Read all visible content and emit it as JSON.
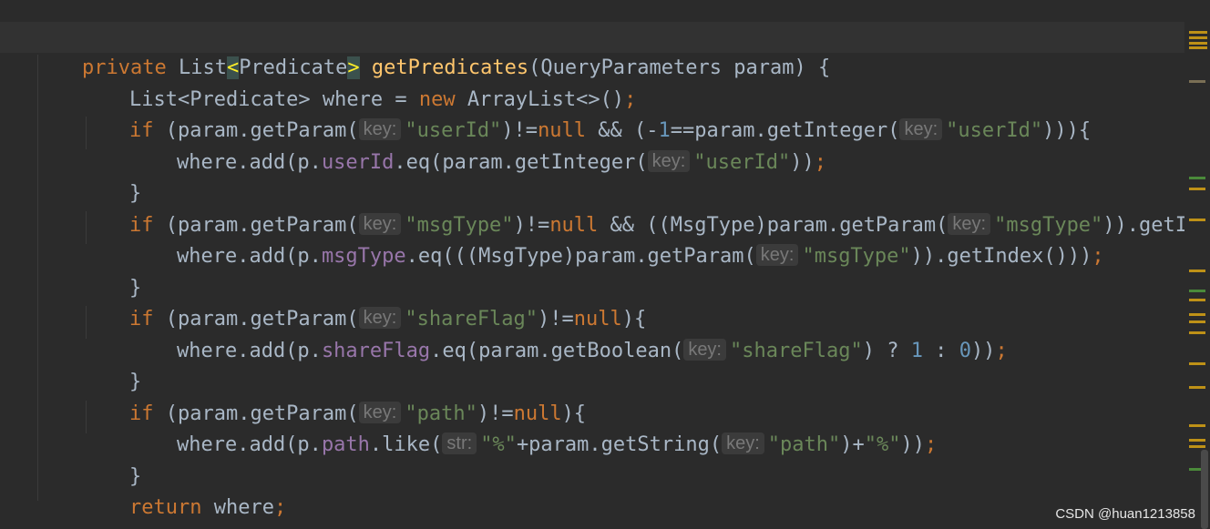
{
  "editor": {
    "lines": {
      "l1": {
        "kw_private": "private",
        "type_list": "List",
        "lt": "<",
        "generic": "Predicate",
        "gt": ">",
        "method": "getPredicates",
        "params": "(QueryParameters param) {"
      },
      "l2": {
        "a": "List<Predicate> where = ",
        "kw_new": "new",
        "b": " ArrayList<>()",
        "semi": ";"
      },
      "l3": {
        "kw_if": "if",
        "a": " (param.getParam(",
        "hint": "key:",
        "s1": "\"userId\"",
        "b": ")!=",
        "kw_null": "null",
        "c": " && (-",
        "n1": "1",
        "d": "==param.getInteger(",
        "hint2": "key:",
        "s2": "\"userId\"",
        "e": "))){"
      },
      "l4": {
        "a": "where.add(p.",
        "field": "userId",
        "b": ".eq(param.getInteger(",
        "hint": "key:",
        "s1": "\"userId\"",
        "c": "))",
        "semi": ";"
      },
      "l5": {
        "a": "}"
      },
      "l6": {
        "kw_if": "if",
        "a": " (param.getParam(",
        "hint": "key:",
        "s1": "\"msgType\"",
        "b": ")!=",
        "kw_null": "null",
        "c": " && ((MsgType)param.getParam(",
        "hint2": "key:",
        "s2": "\"msgType\"",
        "d": ")).getIndex()"
      },
      "l7": {
        "a": "where.add(p.",
        "field": "msgType",
        "b": ".eq(((MsgType)param.getParam(",
        "hint": "key:",
        "s1": "\"msgType\"",
        "c": ")).getIndex()))",
        "semi": ";"
      },
      "l8": {
        "a": "}"
      },
      "l9": {
        "kw_if": "if",
        "a": " (param.getParam(",
        "hint": "key:",
        "s1": "\"shareFlag\"",
        "b": ")!=",
        "kw_null": "null",
        "c": "){"
      },
      "l10": {
        "a": "where.add(p.",
        "field": "shareFlag",
        "b": ".eq(param.getBoolean(",
        "hint": "key:",
        "s1": "\"shareFlag\"",
        "c": ") ? ",
        "n1": "1",
        "d": " : ",
        "n2": "0",
        "e": "))",
        "semi": ";"
      },
      "l11": {
        "a": "}"
      },
      "l12": {
        "kw_if": "if",
        "a": " (param.getParam(",
        "hint": "key:",
        "s1": "\"path\"",
        "b": ")!=",
        "kw_null": "null",
        "c": "){"
      },
      "l13": {
        "a": "where.add(p.",
        "field": "path",
        "b": ".like(",
        "hint": "str:",
        "s1": "\"%\"",
        "c": "+param.getString(",
        "hint2": "key:",
        "s2": "\"path\"",
        "d": ")+",
        "s3": "\"%\"",
        "e": "))",
        "semi": ";"
      },
      "l14": {
        "a": "}"
      },
      "l15": {
        "kw_return": "return",
        "a": " where",
        "semi": ";"
      },
      "l16": {
        "a": "}"
      }
    }
  },
  "colors": {
    "background": "#2b2b2b",
    "keyword": "#cc7832",
    "method": "#ffc66d",
    "string": "#6a8759",
    "number": "#6897bb",
    "field": "#9876aa",
    "text": "#a9b7c6",
    "hint_bg": "#3b3b3b",
    "hint_text": "#787878"
  },
  "icons": {
    "intention": "lightbulb-icon",
    "inspection": "inspection-summary-icon"
  },
  "watermark": "CSDN @huan1213858"
}
